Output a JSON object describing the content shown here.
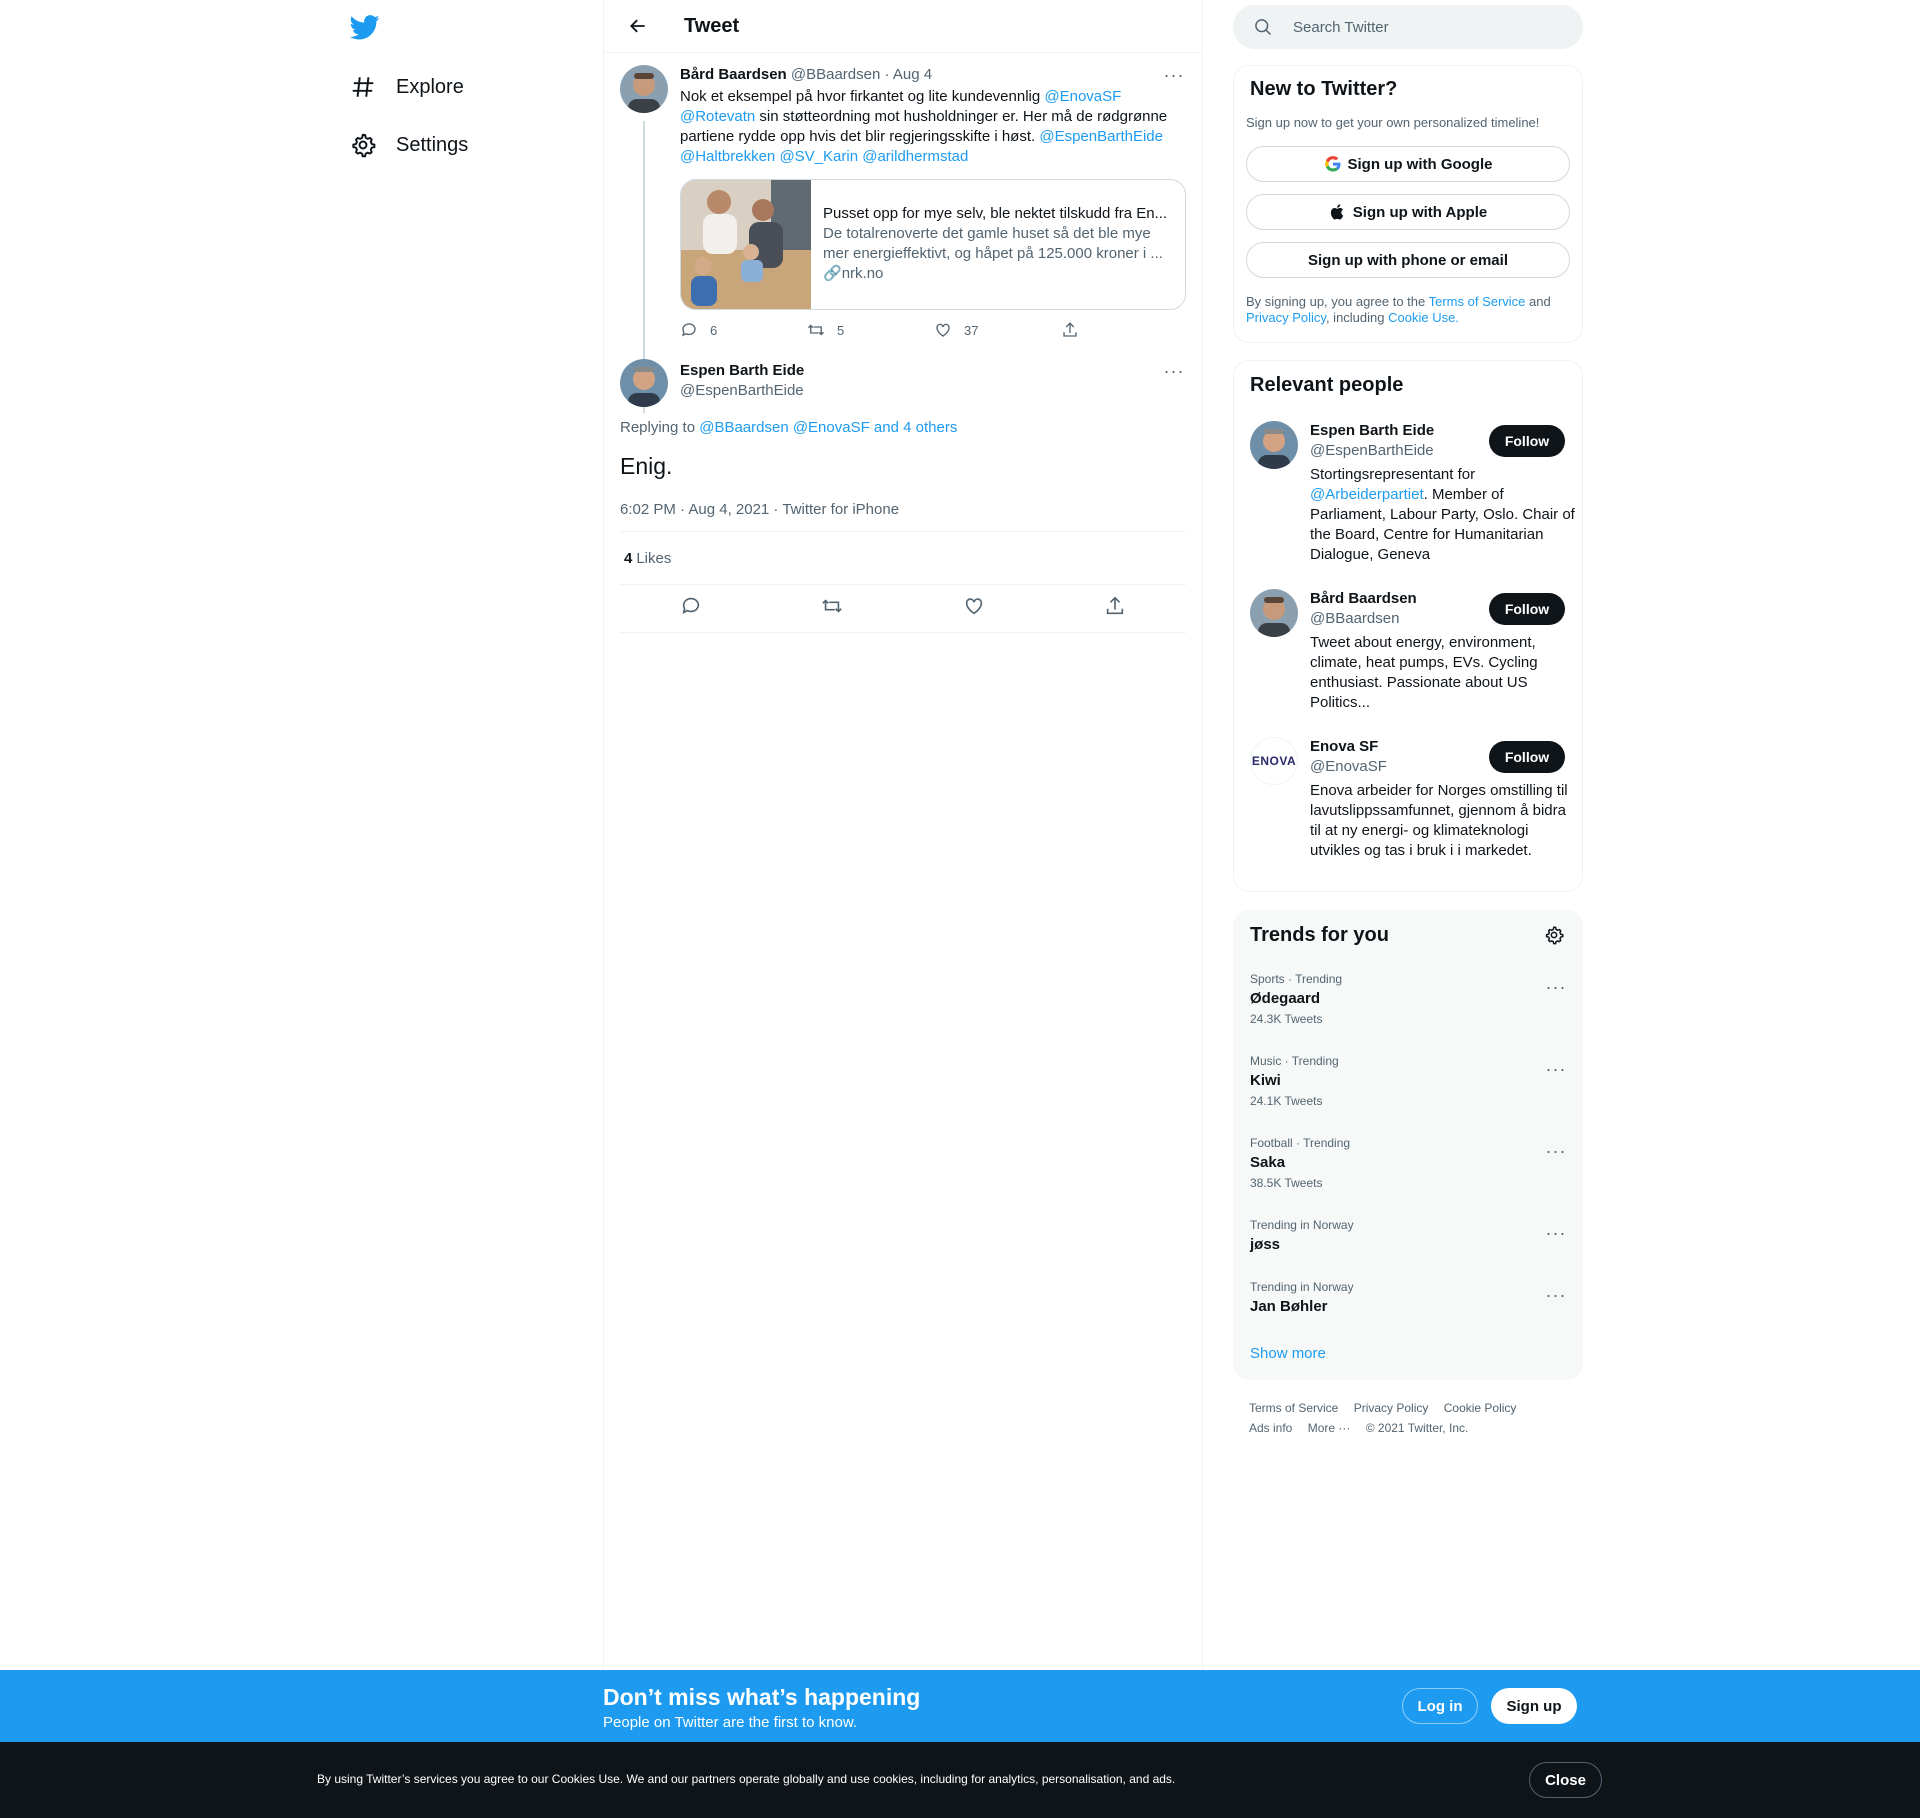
{
  "nav": {
    "explore": "Explore",
    "settings": "Settings"
  },
  "header": {
    "title": "Tweet"
  },
  "tweet1": {
    "name": "Bård Baardsen",
    "handle": "@BBaardsen",
    "date": "· Aug 4",
    "text_part1": "Nok et eksempel på hvor firkantet og lite kundevennlig ",
    "mention1": "@EnovaSF",
    "mention2": "@Rotevatn",
    "text_part2": " sin støtteordning mot husholdninger er. Her må de rødgrønne partiene rydde opp hvis det blir regjeringsskifte i høst. ",
    "mention3": "@EspenBarthEide",
    "mention4": "@Haltbrekken",
    "mention5": "@SV_Karin",
    "mention6": "@arildhermstad",
    "card_title": "Pusset opp for mye selv, ble nektet tilskudd fra En...",
    "card_desc": "De totalrenoverte det gamle huset så det ble mye mer energieffektivt, og håpet på 125.000 kroner i ...",
    "card_link": "nrk.no",
    "replies": "6",
    "retweets": "5",
    "likes": "37"
  },
  "tweet2": {
    "name": "Espen Barth Eide",
    "handle": "@EspenBarthEide",
    "replying_prefix": "Replying to ",
    "replying_to": "@BBaardsen @EnovaSF and 4 others",
    "text": "Enig.",
    "meta": "6:02 PM · Aug 4, 2021 · Twitter for iPhone",
    "likes_count": "4",
    "likes_label": "Likes"
  },
  "search": {
    "placeholder": "Search Twitter"
  },
  "new_to_twitter": {
    "title": "New to Twitter?",
    "subtitle": "Sign up now to get your own personalized timeline!",
    "google": "Sign up with Google",
    "apple": "Sign up with Apple",
    "phone": "Sign up with phone or email",
    "legal1": "By signing up, you agree to the ",
    "tos": "Terms of Service",
    "legal2": " and ",
    "privacy": "Privacy Policy",
    "legal3": ", including ",
    "cookie": "Cookie Use."
  },
  "relevant": {
    "title": "Relevant people",
    "follow_label": "Follow",
    "people": [
      {
        "name": "Espen Barth Eide",
        "handle": "@EspenBarthEide",
        "bio1": "Stortingsrepresentant for ",
        "bio_link": "@Arbeiderpartiet",
        "bio2": ". Member of Parliament, Labour Party, Oslo. Chair of the Board, Centre for Humanitarian Dialogue, Geneva"
      },
      {
        "name": "Bård Baardsen",
        "handle": "@BBaardsen",
        "bio": "Tweet about energy, environment, climate, heat pumps, EVs. Cycling enthusiast. Passionate about US Politics..."
      },
      {
        "name": "Enova SF",
        "handle": "@EnovaSF",
        "bio": "Enova arbeider for Norges omstilling til lavutslippssamfunnet, gjennom å bidra til at ny energi- og klimateknologi utvikles og tas i bruk i i markedet.",
        "logo_text": "ENOVA"
      }
    ]
  },
  "trends": {
    "title": "Trends for you",
    "items": [
      {
        "context": "Sports · Trending",
        "name": "Ødegaard",
        "count": "24.3K Tweets"
      },
      {
        "context": "Music · Trending",
        "name": "Kiwi",
        "count": "24.1K Tweets"
      },
      {
        "context": "Football · Trending",
        "name": "Saka",
        "count": "38.5K Tweets"
      },
      {
        "context": "Trending in Norway",
        "name": "jøss",
        "count": ""
      },
      {
        "context": "Trending in Norway",
        "name": "Jan Bøhler",
        "count": ""
      }
    ],
    "show_more": "Show more"
  },
  "footer": {
    "tos": "Terms of Service",
    "privacy": "Privacy Policy",
    "cookie": "Cookie Policy",
    "ads": "Ads info",
    "more": "More ···",
    "copyright": "© 2021 Twitter, Inc."
  },
  "signup_bar": {
    "title": "Don’t miss what’s happening",
    "subtitle": "People on Twitter are the first to know.",
    "login": "Log in",
    "signup": "Sign up"
  },
  "cookie_bar": {
    "text": "By using Twitter’s services you agree to our Cookies Use. We and our partners operate globally and use cookies, including for analytics, personalisation, and ads.",
    "close": "Close"
  },
  "colors": {
    "accent": "#1d9bf0",
    "dark": "#0f1419",
    "muted": "#536471"
  }
}
